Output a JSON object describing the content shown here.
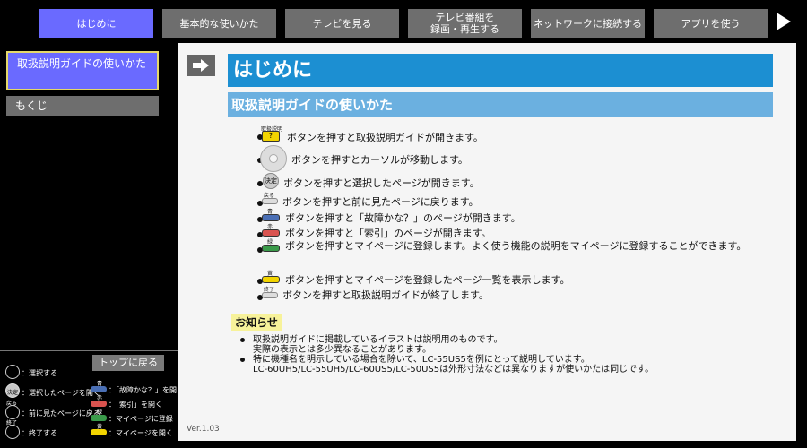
{
  "nav": {
    "tabs": [
      {
        "label": "はじめに"
      },
      {
        "label": "基本的な使いかた"
      },
      {
        "label": "テレビを見る"
      },
      {
        "label": "テレビ番組を\n録画・再生する"
      },
      {
        "label": "ネットワークに接続する"
      },
      {
        "label": "アプリを使う"
      }
    ],
    "active_tab": "はじめに",
    "next_icon": "triangle-right-icon"
  },
  "sidebar": {
    "items": [
      {
        "label": "取扱説明ガイドの使いかた",
        "selected": true
      },
      {
        "label": "もくじ",
        "selected": false
      }
    ],
    "top_back_label": "トップに戻る",
    "keys": {
      "select": "：選択する",
      "enter": "：選択したページを開く",
      "enter_key": "決定",
      "back": "：前に見たページに戻る",
      "back_key": "戻る",
      "end": "：終了する",
      "end_key": "終了",
      "blue": "：「故障かな？」を開く",
      "blue_key": "青",
      "red": "：「索引」を開く",
      "red_key": "赤",
      "green": "：マイページに登録",
      "green_key": "緑",
      "yellow": "：マイページを開く",
      "yellow_key": "黄"
    }
  },
  "main": {
    "page_title": "はじめに",
    "section_title": "取扱説明ガイドの使いかた",
    "items": [
      {
        "icon": "guide-button-icon",
        "caption": "取扱説明",
        "glyph": "?",
        "text": "ボタンを押すと取扱説明ガイドが開きます。"
      },
      {
        "icon": "dpad-icon",
        "text": "ボタンを押すとカーソルが移動します。"
      },
      {
        "icon": "enter-button-icon",
        "glyph": "決定",
        "text": "ボタンを押すと選択したページが開きます。"
      },
      {
        "icon": "back-button-icon",
        "caption": "戻る",
        "text": "ボタンを押すと前に見たページに戻ります。"
      },
      {
        "icon": "blue-button-icon",
        "caption": "青",
        "text": "ボタンを押すと「故障かな？」のページが開きます。"
      },
      {
        "icon": "red-button-icon",
        "caption": "赤",
        "text": "ボタンを押すと「索引」のページが開きます。"
      },
      {
        "icon": "green-button-icon",
        "caption": "緑",
        "text": "ボタンを押すとマイページに登録します。よく使う機能の説明をマイページに登録することができます。"
      },
      {
        "icon": "yellow-button-icon",
        "caption": "黄",
        "text": "ボタンを押すとマイページを登録したページ一覧を表示します。"
      },
      {
        "icon": "end-button-icon",
        "caption": "終了",
        "text": "ボタンを押すと取扱説明ガイドが終了します。"
      }
    ],
    "notice": {
      "label": "お知らせ",
      "lines": [
        "取扱説明ガイドに掲載しているイラストは説明用のものです。",
        "実際の表示とは多少異なることがあります。",
        "特に機種名を明示している場合を除いて、LC-55US5を例にとって説明しています。",
        "LC-60UH5/LC-55UH5/LC-60US5/LC-50US5は外形寸法などは異なりますが使いかたは同じです。"
      ]
    },
    "version": "Ver.1.03"
  },
  "colors": {
    "active_tab": "#6a6aff",
    "inactive_tab": "#6e6e6e",
    "title_bar": "#1c8fd2",
    "section_bar": "#6bb0e0",
    "notice_bg": "#f7f29a",
    "blue_key": "#4a6fb5",
    "red_key": "#d9534f",
    "green_key": "#3a9a4a",
    "yellow_key": "#f2d400"
  }
}
